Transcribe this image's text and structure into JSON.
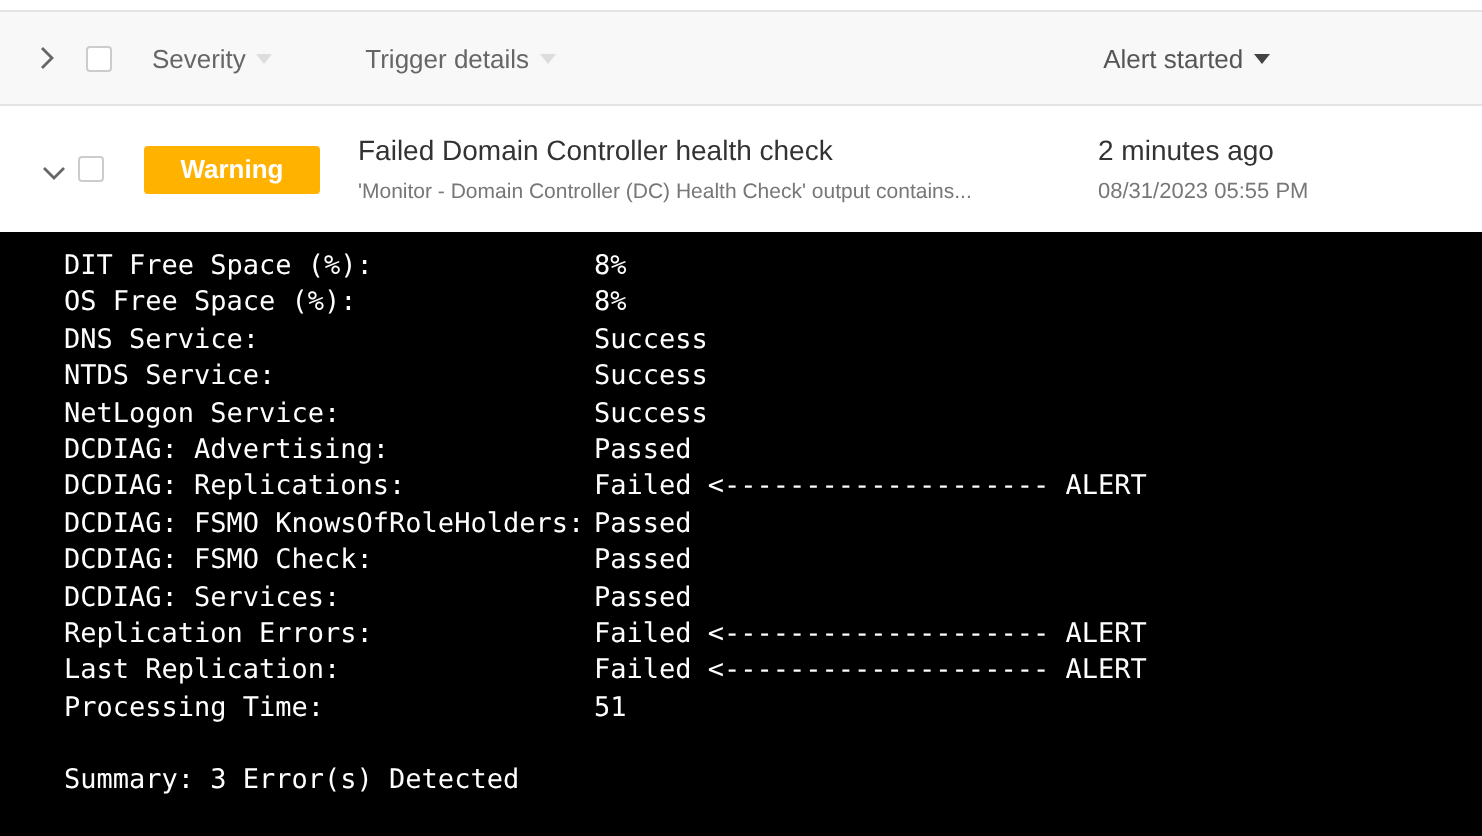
{
  "table": {
    "columns": [
      {
        "label": "Severity",
        "sorted": false
      },
      {
        "label": "Trigger details",
        "sorted": false
      },
      {
        "label": "Alert started",
        "sorted": true
      }
    ],
    "header_checked": false,
    "rows": [
      {
        "expanded": true,
        "checked": false,
        "severity": "Warning",
        "color": "#ffb300",
        "title": "Failed Domain Controller health check",
        "description": "'Monitor - Domain Controller (DC) Health Check' output contains...",
        "relative_time": "2 minutes ago",
        "timestamp": "08/31/2023 05:55 PM"
      }
    ]
  },
  "console": {
    "lines": [
      {
        "label": "DIT Free Space (%):",
        "value": "8%"
      },
      {
        "label": "OS Free Space (%):",
        "value": "8%"
      },
      {
        "label": "DNS Service:",
        "value": "Success"
      },
      {
        "label": "NTDS Service:",
        "value": "Success"
      },
      {
        "label": "NetLogon Service:",
        "value": "Success"
      },
      {
        "label": "DCDIAG: Advertising:",
        "value": "Passed"
      },
      {
        "label": "DCDIAG: Replications:",
        "value": "Failed <-------------------- ALERT"
      },
      {
        "label": "DCDIAG: FSMO KnowsOfRoleHolders:",
        "value": "Passed"
      },
      {
        "label": "DCDIAG: FSMO Check:",
        "value": "Passed"
      },
      {
        "label": "DCDIAG: Services:",
        "value": "Passed"
      },
      {
        "label": "Replication Errors:",
        "value": "Failed <-------------------- ALERT"
      },
      {
        "label": "Last Replication:",
        "value": "Failed <-------------------- ALERT"
      },
      {
        "label": "Processing Time:",
        "value": "51"
      }
    ],
    "summary": "Summary: 3 Error(s) Detected"
  }
}
